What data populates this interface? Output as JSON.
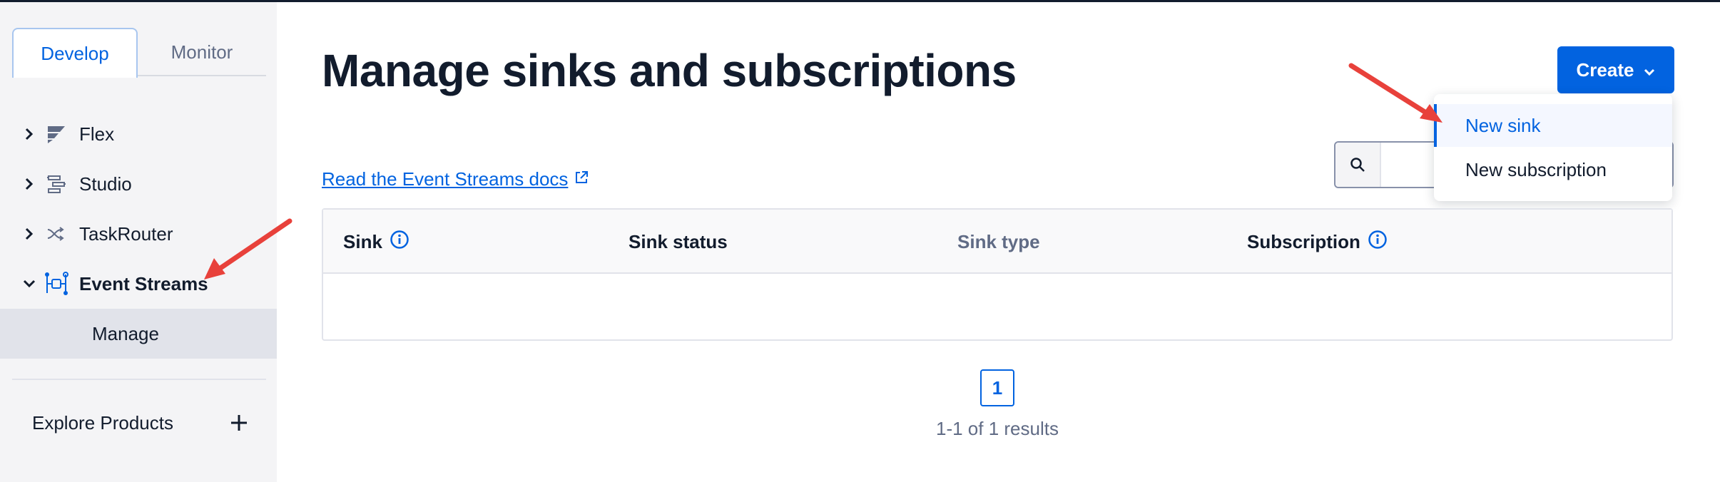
{
  "sidebar": {
    "tabs": [
      {
        "label": "Develop",
        "active": true
      },
      {
        "label": "Monitor",
        "active": false
      }
    ],
    "items": [
      {
        "label": "Flex",
        "icon": "flex-icon",
        "expanded": false
      },
      {
        "label": "Studio",
        "icon": "studio-icon",
        "expanded": false
      },
      {
        "label": "TaskRouter",
        "icon": "taskrouter-icon",
        "expanded": false
      },
      {
        "label": "Event Streams",
        "icon": "event-streams-icon",
        "expanded": true
      }
    ],
    "sub_item": {
      "label": "Manage",
      "selected": true
    },
    "explore": {
      "label": "Explore Products",
      "icon": "plus-icon"
    }
  },
  "main": {
    "title": "Manage sinks and subscriptions",
    "doc_link": "Read the Event Streams docs",
    "create_button": "Create",
    "search": {
      "placeholder": ""
    },
    "dropdown": [
      {
        "label": "New sink",
        "highlighted": true
      },
      {
        "label": "New subscription",
        "highlighted": false
      }
    ],
    "table": {
      "columns": [
        {
          "label": "Sink",
          "info": true
        },
        {
          "label": "Sink status",
          "info": false
        },
        {
          "label": "Sink type",
          "info": false
        },
        {
          "label": "Subscription",
          "info": true
        }
      ],
      "rows": []
    },
    "pagination": {
      "current": "1",
      "results": "1-1 of 1 results"
    }
  },
  "colors": {
    "accent": "#0263e0",
    "text": "#121c2d",
    "muted": "#606b85",
    "sidebar_bg": "#f4f4f6",
    "annotation_arrow": "#e8413b"
  }
}
